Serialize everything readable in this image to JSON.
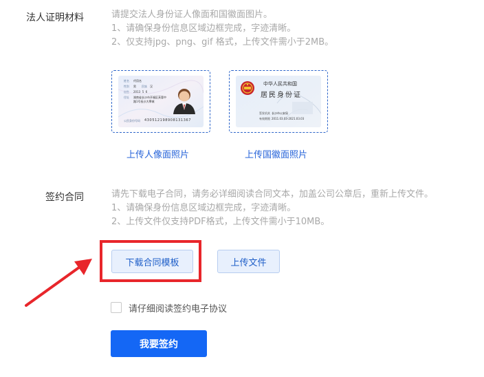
{
  "legal_person_section": {
    "label": "法人证明材料",
    "hints": [
      "请提交法人身份证人像面和国徽面图片。",
      "1、请确保身份信息区域边框完成，字迹清晰。",
      "2、仅支持jpg、png、gif 格式，上传文件需小于2MB。"
    ],
    "portrait_card": {
      "name_key": "姓名",
      "name_value": "代用名",
      "gender_key": "性别",
      "gender_value": "男",
      "ethnic_key": "民族",
      "ethnic_value": "汉",
      "birth_key": "出生",
      "birth_value": "2013  5  6",
      "address_key": "住址",
      "address_value_1": "湖南省长沙市开福区芙蓉中",
      "address_value_2": "路1号長沙大學城",
      "id_key": "公民身份号码",
      "id_value": "430512198908131367"
    },
    "emblem_card": {
      "title_1": "中华人民共和国",
      "title_2": "居民身份证",
      "issuer_key": "签发机关",
      "issuer_value": "长沙市公安局",
      "valid_key": "有效期限",
      "valid_value": "2011.03.03-2021.03.03"
    },
    "upload_portrait": "上传人像面照片",
    "upload_emblem": "上传国徽面照片"
  },
  "contract_section": {
    "label": "签约合同",
    "hints": [
      "请先下载电子合同，请务必详细阅读合同文本，加盖公司公章后，重新上传文件。",
      "1、请确保身份信息区域边框完成，字迹清晰。",
      "2、上传文件仅支持PDF格式，上传文件需小于10MB。"
    ],
    "download_button": "下载合同模板",
    "upload_button": "上传文件"
  },
  "agreement": {
    "checkbox_label": "请仔细阅读签约电子协议",
    "checked": false
  },
  "submit_button": "我要签约",
  "colors": {
    "primary": "#1467f5",
    "link": "#2663d9",
    "annotation_red": "#e8262b"
  }
}
